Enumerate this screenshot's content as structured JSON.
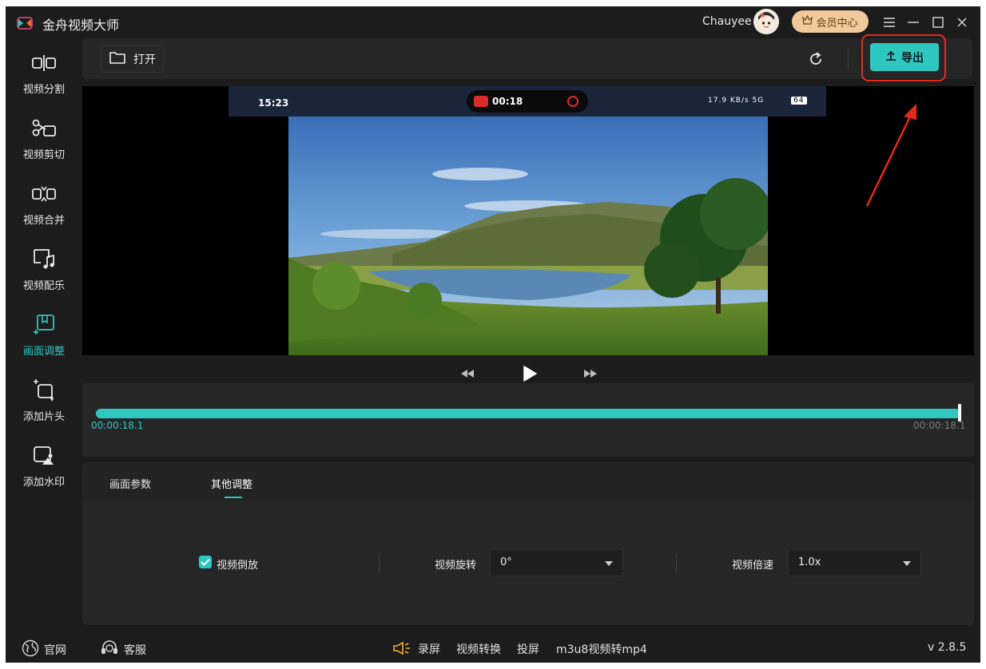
{
  "app": {
    "title": "金舟视频大师",
    "version": "v 2.8.5"
  },
  "header": {
    "username": "Chauyee",
    "vip_label": "会员中心"
  },
  "sidebar": {
    "items": [
      {
        "label": "视频分割",
        "icon": "split-icon"
      },
      {
        "label": "视频剪切",
        "icon": "scissors-icon"
      },
      {
        "label": "视频合并",
        "icon": "merge-icon"
      },
      {
        "label": "视频配乐",
        "icon": "music-icon"
      },
      {
        "label": "画面调整",
        "icon": "crop-adjust-icon",
        "active": true
      },
      {
        "label": "添加片头",
        "icon": "intro-icon"
      },
      {
        "label": "添加水印",
        "icon": "watermark-icon"
      }
    ]
  },
  "toolbar": {
    "open_label": "打开",
    "export_label": "导出"
  },
  "video": {
    "phone_time": "15:23",
    "record_time": "00:18",
    "status_icons": "17.9 KB/s  5G",
    "battery": "64"
  },
  "timeline": {
    "current": "00:00:18.1",
    "total": "00:00:18.1",
    "progress": 1.0
  },
  "panel": {
    "tabs": [
      "画面参数",
      "其他调整"
    ],
    "active_tab": 1,
    "reverse_label": "视频倒放",
    "reverse_checked": true,
    "rotate_label": "视频旋转",
    "rotate_value": "0°",
    "speed_label": "视频倍速",
    "speed_value": "1.0x"
  },
  "footer": {
    "website": "官网",
    "support": "客服",
    "links": [
      "录屏",
      "视频转换",
      "投屏",
      "m3u8视频转mp4"
    ]
  },
  "colors": {
    "accent": "#2ec7c0",
    "highlight": "#e8281e",
    "vip": "#f2c99c"
  }
}
